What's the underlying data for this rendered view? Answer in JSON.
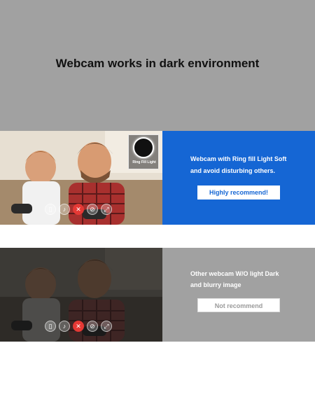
{
  "header": {
    "title": "Webcam works in dark environment"
  },
  "comparison": {
    "with_light": {
      "description_line1": "Webcam with Ring fill Light Soft",
      "description_line2": "and avoid disturbing  others.",
      "badge_label": "Ring Fill Light",
      "cta": "Highly recommend!",
      "accent_color": "#1566d4"
    },
    "without_light": {
      "description_line1": "Other webcam W/O light Dark",
      "description_line2": "and blurry image",
      "cta": "Not recommend",
      "accent_color": "#a1a1a1"
    }
  },
  "controls": {
    "icons": [
      "mouse-icon",
      "microphone-icon",
      "end-call-icon",
      "camera-off-icon",
      "fullscreen-icon"
    ]
  }
}
